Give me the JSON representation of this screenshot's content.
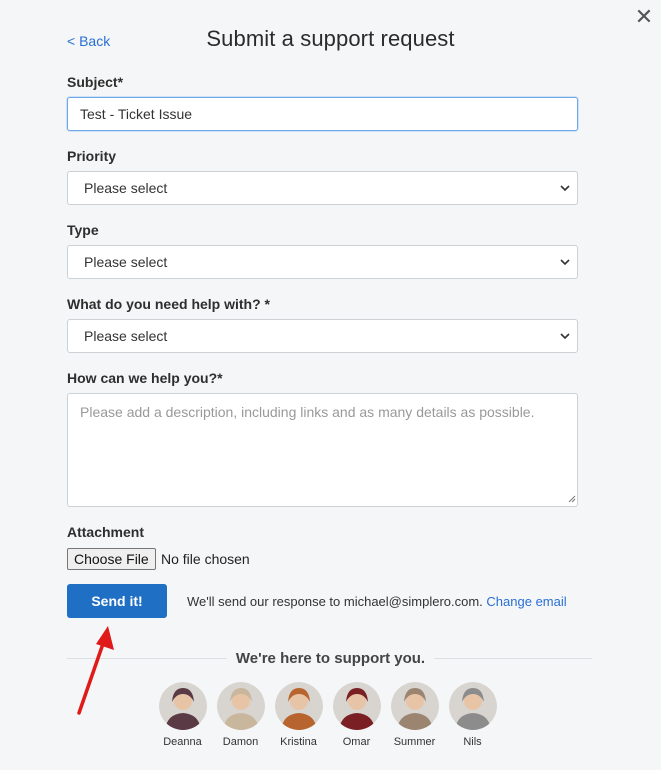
{
  "header": {
    "back_label": "< Back",
    "title": "Submit a support request",
    "close_icon": "close-icon"
  },
  "form": {
    "subject": {
      "label": "Subject*",
      "value": "Test - Ticket Issue"
    },
    "priority": {
      "label": "Priority",
      "selected": "Please select"
    },
    "type": {
      "label": "Type",
      "selected": "Please select"
    },
    "help_topic": {
      "label": "What do you need help with? *",
      "selected": "Please select"
    },
    "description": {
      "label": "How can we help you?*",
      "placeholder": "Please add a description, including links and as many details as possible.",
      "value": ""
    },
    "attachment": {
      "label": "Attachment",
      "button_label": "Choose File",
      "status": "No file chosen"
    },
    "submit_label": "Send it!"
  },
  "notice": {
    "text": "We'll send our response to michael@simplero.com.",
    "link_label": "Change email"
  },
  "support": {
    "heading": "We're here to support you.",
    "team": [
      {
        "name": "Deanna",
        "color": "#5a3a44"
      },
      {
        "name": "Damon",
        "color": "#c9b79d"
      },
      {
        "name": "Kristina",
        "color": "#b8642f"
      },
      {
        "name": "Omar",
        "color": "#7a1f24"
      },
      {
        "name": "Summer",
        "color": "#9b8470"
      },
      {
        "name": "Nils",
        "color": "#8c8c8c"
      }
    ]
  },
  "colors": {
    "accent": "#1f6fc5",
    "link": "#2a6fd6",
    "annotation_arrow": "#e01919"
  }
}
